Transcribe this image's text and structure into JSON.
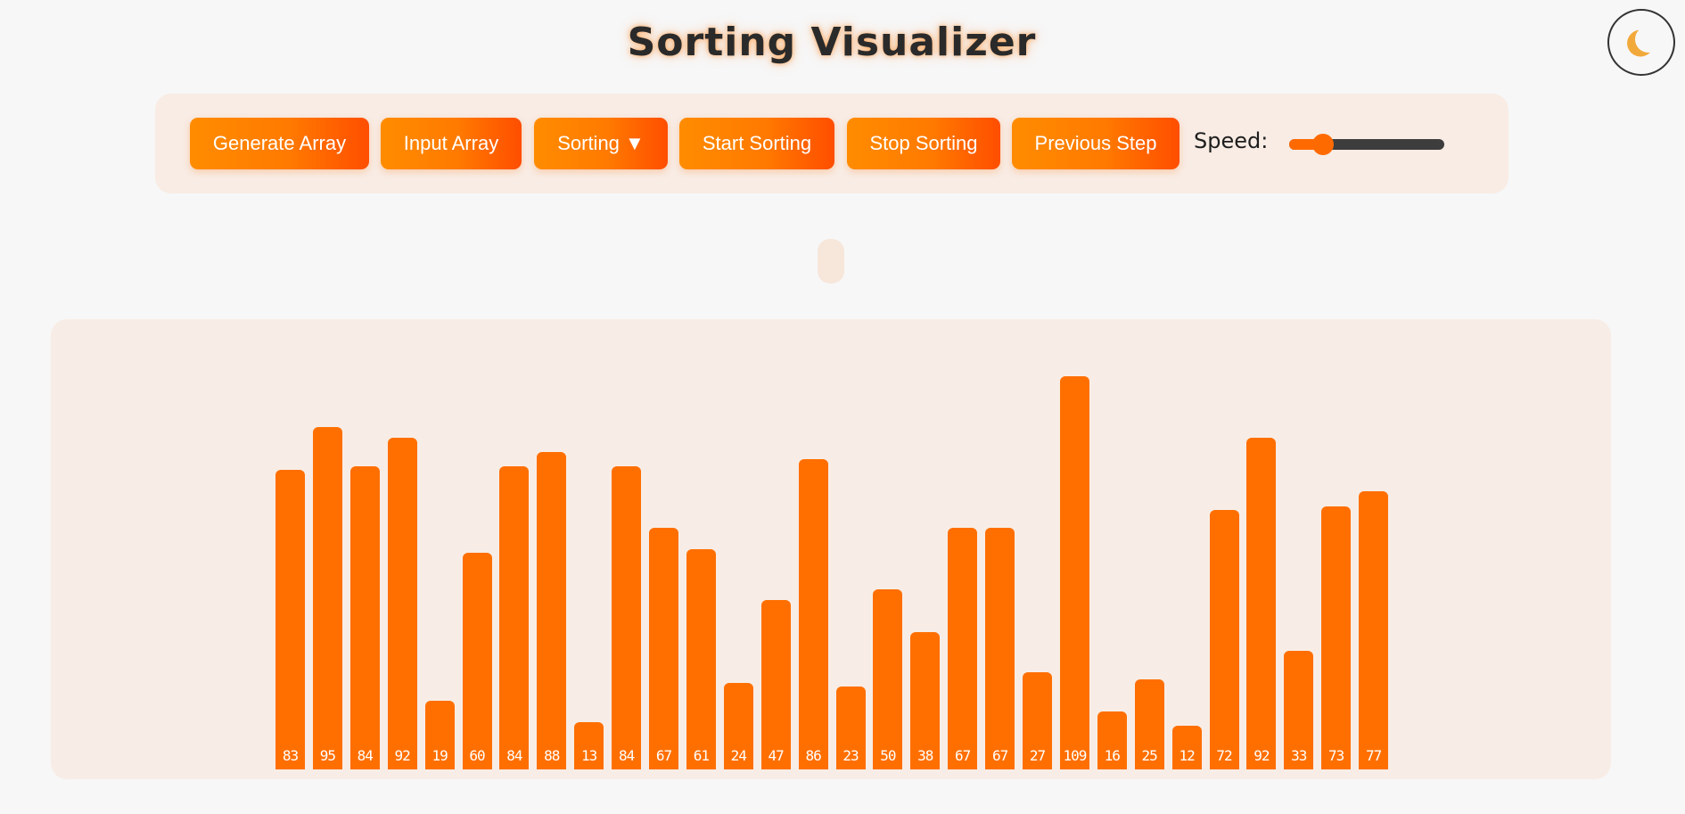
{
  "header": {
    "title": "Sorting Visualizer"
  },
  "theme_toggle": {
    "icon": "moon-icon"
  },
  "controls": {
    "buttons": [
      {
        "id": "generate",
        "label": "Generate Array"
      },
      {
        "id": "input",
        "label": "Input Array"
      },
      {
        "id": "sorting",
        "label": "Sorting ▼"
      },
      {
        "id": "start",
        "label": "Start Sorting"
      },
      {
        "id": "stop",
        "label": "Stop Sorting"
      },
      {
        "id": "previous",
        "label": "Previous Step"
      }
    ],
    "speed_label": "Speed:",
    "speed_value": 0.22
  },
  "colors": {
    "accent": "#ff6f00",
    "button_gradient_start": "#ff8c00",
    "button_gradient_end": "#ff4e00",
    "panel_bg": "#f8ede6",
    "page_bg": "#f7f7f7"
  },
  "chart_data": {
    "type": "bar",
    "values": [
      83,
      95,
      84,
      92,
      19,
      60,
      84,
      88,
      13,
      84,
      67,
      61,
      24,
      47,
      86,
      23,
      50,
      38,
      67,
      67,
      27,
      109,
      16,
      25,
      12,
      72,
      92,
      33,
      73,
      77
    ],
    "ylim": [
      0,
      109
    ],
    "grid": false
  }
}
